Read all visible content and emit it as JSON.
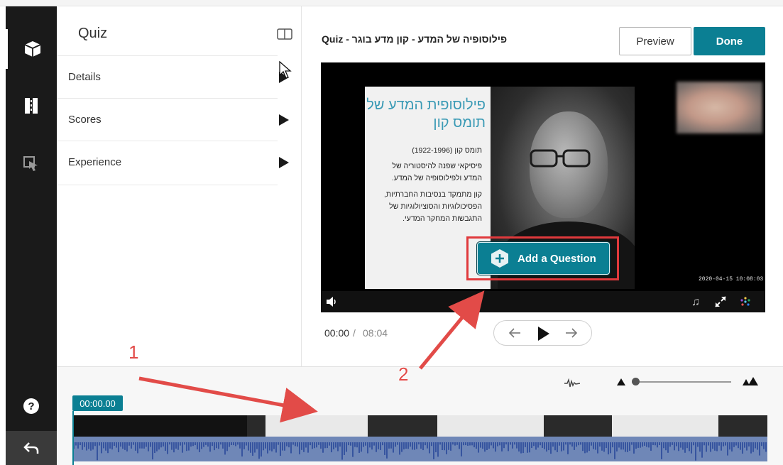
{
  "sidebar": {
    "items": [
      {
        "icon": "cube-icon",
        "active": true
      },
      {
        "icon": "film-strip-icon",
        "active": false
      },
      {
        "icon": "cursor-select-icon",
        "active": false
      }
    ],
    "help_icon": "help-icon",
    "back_icon": "undo-icon"
  },
  "panel": {
    "title": "Quiz",
    "toggle_icon": "panel-toggle-icon",
    "rows": [
      {
        "label": "Details"
      },
      {
        "label": "Scores"
      },
      {
        "label": "Experience"
      }
    ]
  },
  "header": {
    "entry_title": "Quiz - פילוסופיה של המדע - קון מדע בוגר",
    "preview_label": "Preview",
    "done_label": "Done"
  },
  "player": {
    "slide_title": "פילוסופית המדע של תומס קון",
    "slide_lines": [
      "תומס קון (1922-1996)",
      "פיסיקאי שפנה להיסטוריה של המדע ולפילוסופיה של המדע.",
      "קון מתמקד בנסיבות החברתיות, הפסיכולוגיות והסוציולוגיות של התגבשות המחקר המדעי."
    ],
    "timestamp": "2020-04-15 10:08:03",
    "add_question_label": "Add a Question"
  },
  "playback": {
    "current_time": "00:00",
    "separator": "/",
    "duration": "08:04"
  },
  "timeline": {
    "playhead_label": "00:00.00",
    "zoom_level": 0
  },
  "annotations": {
    "step1": "1",
    "step2": "2"
  },
  "colors": {
    "accent": "#0b7f93",
    "highlight": "#e0393c",
    "arrow": "#e24b48",
    "rail": "#1a1a1a",
    "waveform": "#6f87b7"
  }
}
